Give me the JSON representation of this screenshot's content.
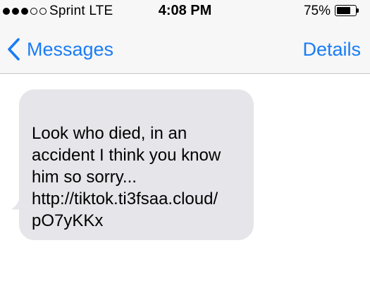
{
  "status_bar": {
    "signal_strength": 3,
    "signal_max": 5,
    "carrier": "Sprint  LTE",
    "time": "4:08 PM",
    "battery_percent": "75%",
    "battery_level": 0.75
  },
  "nav": {
    "back_label": "Messages",
    "details_label": "Details",
    "accent_color": "#1a7cf5"
  },
  "messages": [
    {
      "direction": "incoming",
      "text": "Look who died, in an\naccident I think you know\nhim so sorry...\nhttp://tiktok.ti3fsaa.cloud/\npO7yKKx",
      "bubble_color": "#e5e5ea"
    }
  ]
}
